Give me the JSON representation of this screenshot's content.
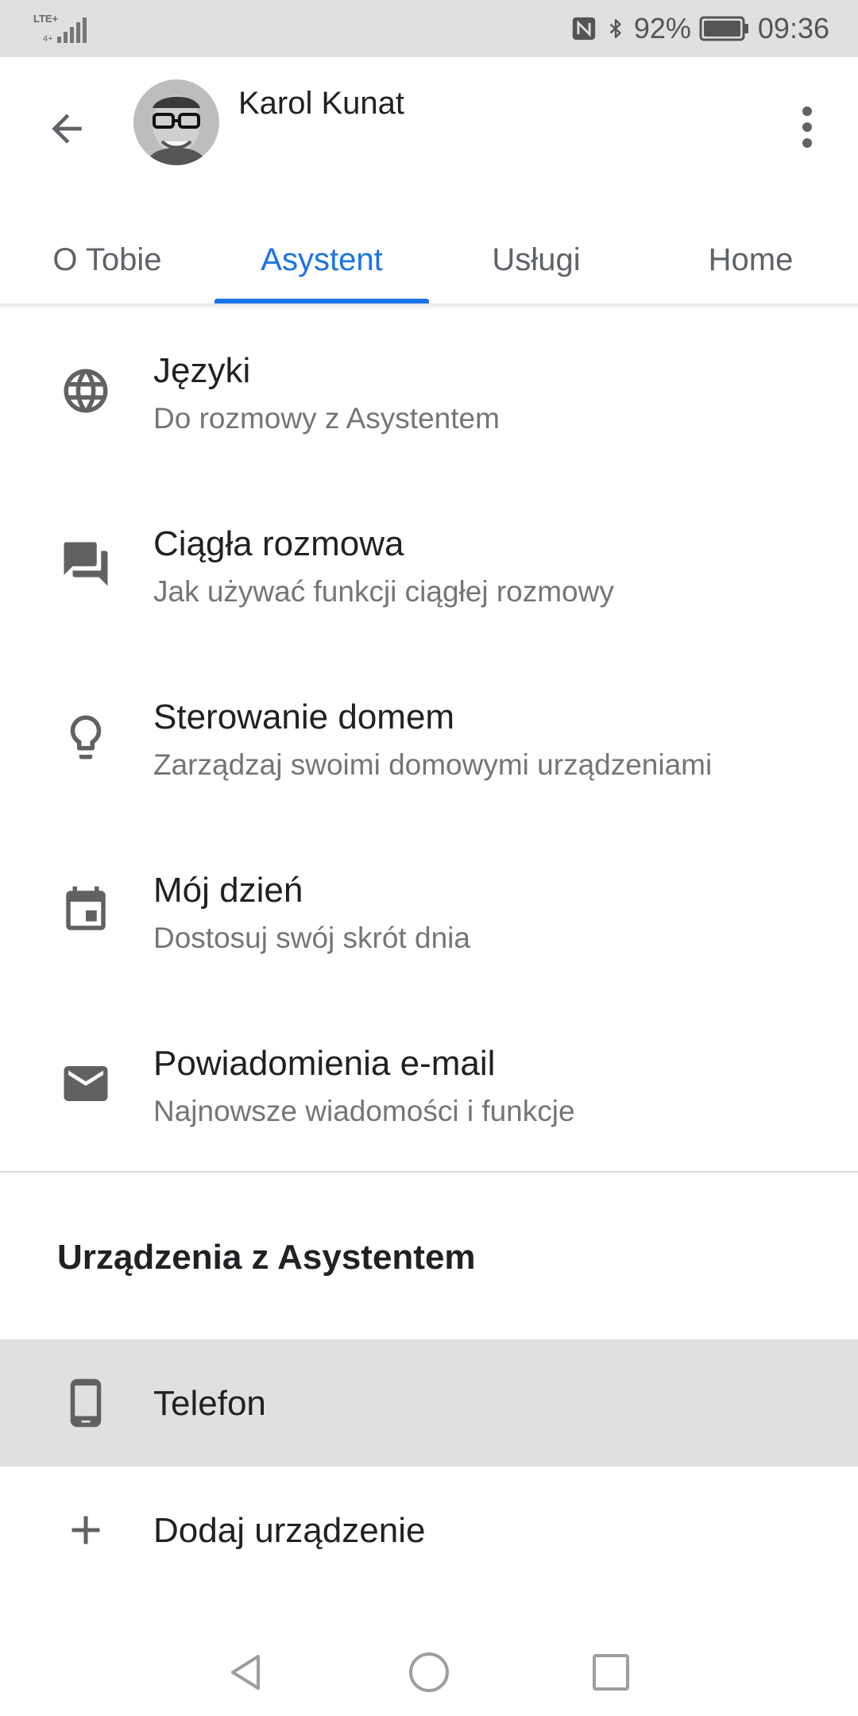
{
  "status_bar": {
    "network": "LTE+",
    "battery_percent": "92%",
    "time": "09:36",
    "icons": [
      "signal-icon",
      "nfc-icon",
      "bluetooth-icon",
      "battery-icon"
    ]
  },
  "header": {
    "user_name": "Karol Kunat",
    "back_icon": "arrow-back-icon",
    "more_icon": "more-vert-icon"
  },
  "tabs": [
    {
      "label": "O Tobie",
      "active": false
    },
    {
      "label": "Asystent",
      "active": true
    },
    {
      "label": "Usługi",
      "active": false
    },
    {
      "label": "Home",
      "active": false
    }
  ],
  "settings": [
    {
      "icon": "globe-icon",
      "title": "Języki",
      "subtitle": "Do rozmowy z Asystentem"
    },
    {
      "icon": "chat-icon",
      "title": "Ciągła rozmowa",
      "subtitle": "Jak używać funkcji ciągłej rozmowy"
    },
    {
      "icon": "lightbulb-icon",
      "title": "Sterowanie domem",
      "subtitle": "Zarządzaj swoimi domowymi urządzeniami"
    },
    {
      "icon": "calendar-icon",
      "title": "Mój dzień",
      "subtitle": "Dostosuj swój skrót dnia"
    },
    {
      "icon": "email-icon",
      "title": "Powiadomienia e-mail",
      "subtitle": "Najnowsze wiadomości i funkcje"
    }
  ],
  "devices_section": {
    "title": "Urządzenia z Asystentem",
    "items": [
      {
        "icon": "phone-icon",
        "label": "Telefon",
        "selected": true
      },
      {
        "icon": "plus-icon",
        "label": "Dodaj urządzenie",
        "selected": false
      }
    ]
  },
  "nav_bar": {
    "icons": [
      "nav-back-icon",
      "nav-home-icon",
      "nav-recents-icon"
    ]
  },
  "colors": {
    "accent": "#1a73e8",
    "status_bar_bg": "#e0e0e0",
    "selected_row_bg": "#e0e0e0",
    "icon_gray": "#616161"
  }
}
